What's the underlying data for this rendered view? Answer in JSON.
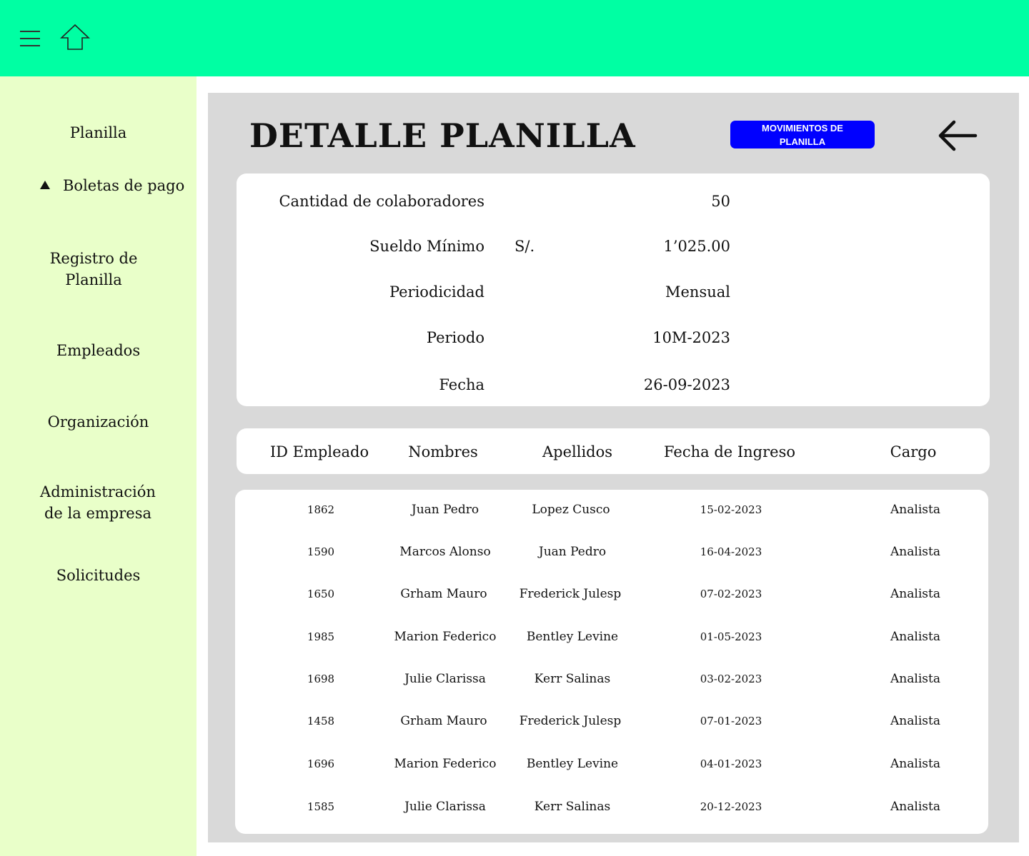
{
  "sidebar": {
    "items": [
      {
        "label": "Planilla"
      },
      {
        "label": "Boletas de pago"
      },
      {
        "label_line1": "Registro de",
        "label_line2": "Planilla"
      },
      {
        "label": "Empleados"
      },
      {
        "label": "Organización"
      },
      {
        "label_line1": "Administración",
        "label_line2": "de la empresa"
      },
      {
        "label": "Solicitudes"
      }
    ]
  },
  "icons": {
    "menu": "hamburger-menu-icon",
    "home": "home-arrow-up-icon",
    "back": "arrow-left-icon",
    "expand": "triangle-up-icon"
  },
  "colors": {
    "topbar": "#00ffa3",
    "sidebar": "#e9ffc9",
    "panel": "#d9d9d9",
    "button": "#0000ff"
  },
  "main": {
    "title": "DETALLE PLANILLA",
    "movimientos_button_line1": "MOVIMIENTOS DE",
    "movimientos_button_line2": "PLANILLA"
  },
  "info": {
    "rows": [
      {
        "label": "Cantidad de colaboradores",
        "unit": "",
        "value": "50"
      },
      {
        "label": "Sueldo Mínimo",
        "unit": "S/.",
        "value": "1’025.00"
      },
      {
        "label": "Periodicidad",
        "unit": "",
        "value": "Mensual"
      },
      {
        "label": "Periodo",
        "unit": "",
        "value": "10M-2023"
      },
      {
        "label": "Fecha",
        "unit": "",
        "value": "26-09-2023"
      }
    ]
  },
  "table": {
    "headers": [
      "ID Empleado",
      "Nombres",
      "Apellidos",
      "Fecha de Ingreso",
      "Cargo"
    ],
    "rows": [
      [
        "1862",
        "Juan Pedro",
        "Lopez Cusco",
        "15-02-2023",
        "Analista"
      ],
      [
        "1590",
        "Marcos Alonso",
        "Juan Pedro",
        "16-04-2023",
        "Analista"
      ],
      [
        "1650",
        "Grham Mauro",
        "Frederick Julesp",
        "07-02-2023",
        "Analista"
      ],
      [
        "1985",
        "Marion Federico",
        "Bentley Levine",
        "01-05-2023",
        "Analista"
      ],
      [
        "1698",
        "Julie Clarissa",
        "Kerr Salinas",
        "03-02-2023",
        "Analista"
      ],
      [
        "1458",
        "Grham Mauro",
        "Frederick Julesp",
        "07-01-2023",
        "Analista"
      ],
      [
        "1696",
        "Marion Federico",
        "Bentley Levine",
        "04-01-2023",
        "Analista"
      ],
      [
        "1585",
        "Julie Clarissa",
        "Kerr Salinas",
        "20-12-2023",
        "Analista"
      ]
    ]
  }
}
